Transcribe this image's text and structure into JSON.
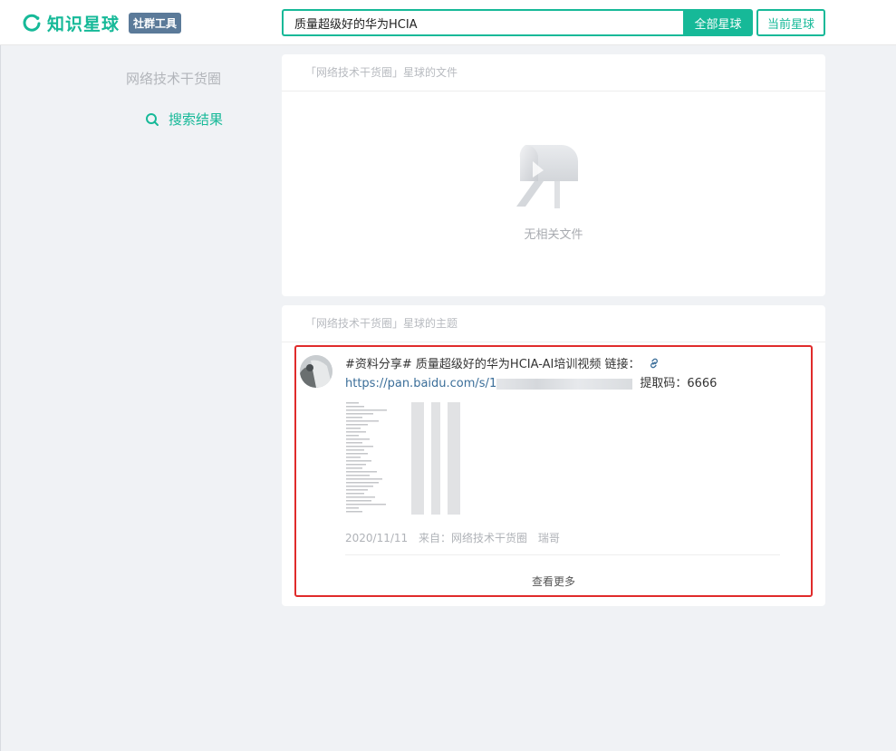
{
  "header": {
    "logo_text": "知识星球",
    "badge": "社群工具",
    "search_value": "质量超级好的华为HCIA",
    "btn_all": "全部星球",
    "btn_current": "当前星球"
  },
  "sidebar": {
    "group_name": "网络技术干货圈",
    "result_label": "搜索结果"
  },
  "files_panel": {
    "title": "「网络技术干货圈」星球的文件",
    "empty_text": "无相关文件"
  },
  "topics_panel": {
    "title": "「网络技术干货圈」星球的主题",
    "post": {
      "text_prefix": "#资料分享# 质量超级好的华为HCIA-AI培训视频  链接：",
      "link": "https://pan.baidu.com/s/1",
      "code_text": "提取码：6666",
      "date": "2020/11/11",
      "source": "来自：网络技术干货圈",
      "author": "瑞哥"
    },
    "more_label": "查看更多"
  },
  "colors": {
    "accent": "#16b998",
    "highlight": "#e02b2b",
    "badge": "#5b7a99"
  }
}
